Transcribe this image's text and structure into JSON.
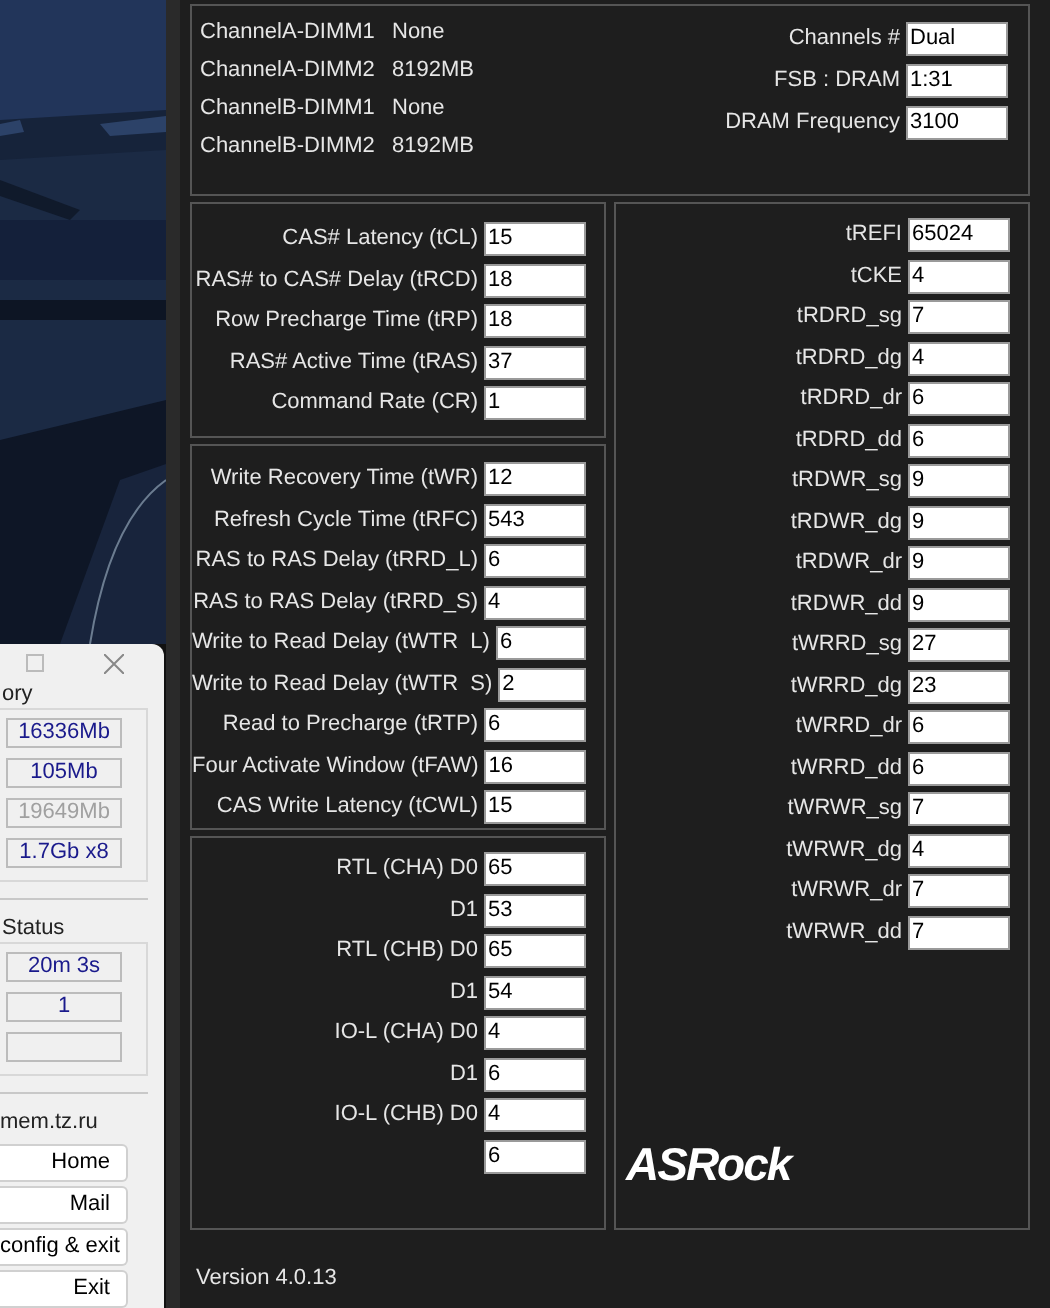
{
  "side_window": {
    "groups": [
      {
        "title": "ory",
        "fields": [
          {
            "value": "16336Mb",
            "disabled": false
          },
          {
            "value": "105Mb",
            "disabled": false
          },
          {
            "value": "19649Mb",
            "disabled": true
          },
          {
            "value": "1.7Gb x8",
            "disabled": false
          }
        ]
      },
      {
        "title": "Status",
        "fields": [
          {
            "value": "20m 3s",
            "disabled": false
          },
          {
            "value": "1",
            "disabled": false
          },
          {
            "kind": "empty"
          }
        ]
      }
    ],
    "links": {
      "title": "mem.tz.ru",
      "buttons": [
        "Home",
        "Mail",
        "config & exit",
        "Exit"
      ]
    }
  },
  "dimms": [
    {
      "slot": "ChannelA-DIMM1",
      "size": "None"
    },
    {
      "slot": "ChannelA-DIMM2",
      "size": "8192MB"
    },
    {
      "slot": "ChannelB-DIMM1",
      "size": "None"
    },
    {
      "slot": "ChannelB-DIMM2",
      "size": "8192MB"
    }
  ],
  "summary": [
    {
      "label": "Channels #",
      "value": "Dual"
    },
    {
      "label": "FSB : DRAM",
      "value": "1:31"
    },
    {
      "label": "DRAM Frequency",
      "value": "3100"
    }
  ],
  "primary_timings": [
    {
      "label": "CAS# Latency (tCL)",
      "value": "15"
    },
    {
      "label": "RAS# to CAS# Delay (tRCD)",
      "value": "18"
    },
    {
      "label": "Row Precharge Time (tRP)",
      "value": "18"
    },
    {
      "label": "RAS# Active Time (tRAS)",
      "value": "37"
    },
    {
      "label": "Command Rate (CR)",
      "value": "1"
    }
  ],
  "secondary_timings": [
    {
      "label": "Write Recovery Time (tWR)",
      "value": "12"
    },
    {
      "label": "Refresh Cycle Time (tRFC)",
      "value": "543"
    },
    {
      "label": "RAS to RAS Delay (tRRD_L)",
      "value": "6"
    },
    {
      "label": "RAS to RAS Delay (tRRD_S)",
      "value": "4"
    },
    {
      "label": "Write to Read Delay (tWTR  L)",
      "value": "6"
    },
    {
      "label": "Write to Read Delay (tWTR  S)",
      "value": "2"
    },
    {
      "label": "Read to Precharge (tRTP)",
      "value": "6"
    },
    {
      "label": "Four Activate Window (tFAW)",
      "value": "16"
    },
    {
      "label": "CAS Write Latency (tCWL)",
      "value": "15"
    }
  ],
  "rtl_iol": [
    {
      "label": "RTL (CHA) D0",
      "value": "65"
    },
    {
      "label": "D1",
      "value": "53"
    },
    {
      "label": "RTL (CHB) D0",
      "value": "65"
    },
    {
      "label": "D1",
      "value": "54"
    },
    {
      "label": "IO-L (CHA) D0",
      "value": "4"
    },
    {
      "label": "D1",
      "value": "6"
    },
    {
      "label": "IO-L (CHB) D0",
      "value": "4"
    },
    {
      "value": "6"
    }
  ],
  "sub_timings": [
    {
      "label": "tREFI",
      "value": "65024"
    },
    {
      "label": "tCKE",
      "value": "4"
    },
    {
      "label": "tRDRD_sg",
      "value": "7"
    },
    {
      "label": "tRDRD_dg",
      "value": "4"
    },
    {
      "label": "tRDRD_dr",
      "value": "6"
    },
    {
      "label": "tRDRD_dd",
      "value": "6"
    },
    {
      "label": "tRDWR_sg",
      "value": "9"
    },
    {
      "label": "tRDWR_dg",
      "value": "9"
    },
    {
      "label": "tRDWR_dr",
      "value": "9"
    },
    {
      "label": "tRDWR_dd",
      "value": "9"
    },
    {
      "label": "tWRRD_sg",
      "value": "27"
    },
    {
      "label": "tWRRD_dg",
      "value": "23"
    },
    {
      "label": "tWRRD_dr",
      "value": "6"
    },
    {
      "label": "tWRRD_dd",
      "value": "6"
    },
    {
      "label": "tWRWR_sg",
      "value": "7"
    },
    {
      "label": "tWRWR_dg",
      "value": "4"
    },
    {
      "label": "tWRWR_dr",
      "value": "7"
    },
    {
      "label": "tWRWR_dd",
      "value": "7"
    }
  ],
  "logo": "ASRock",
  "version": "Version 4.0.13"
}
